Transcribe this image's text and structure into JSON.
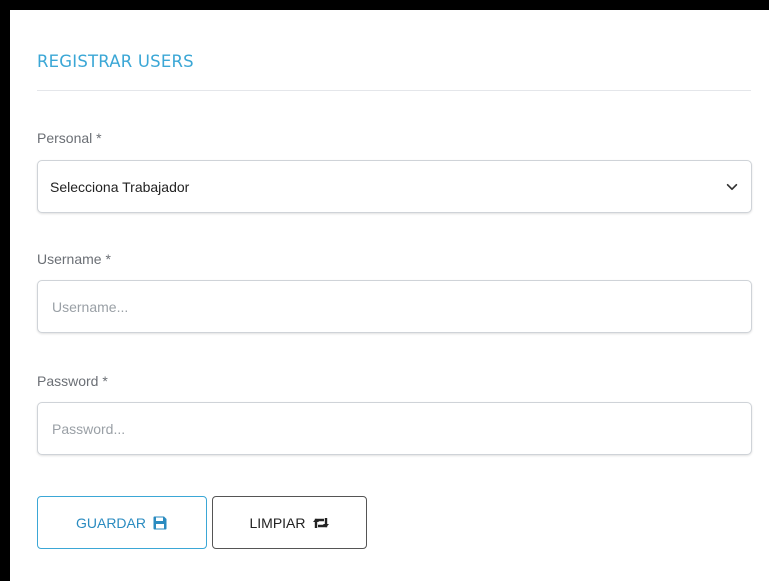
{
  "form": {
    "title": "REGISTRAR USERS",
    "personal": {
      "label": "Personal *",
      "selected": "Selecciona Trabajador"
    },
    "username": {
      "label": "Username *",
      "placeholder": "Username...",
      "value": ""
    },
    "password": {
      "label": "Password *",
      "placeholder": "Password...",
      "value": ""
    },
    "buttons": {
      "save_label": "GUARDAR",
      "save_icon": "floppy-disk-icon",
      "clear_label": "LIMPIAR",
      "clear_icon": "retweet-icon"
    }
  },
  "colors": {
    "accent": "#3ba7d6",
    "frame": "#000000"
  }
}
